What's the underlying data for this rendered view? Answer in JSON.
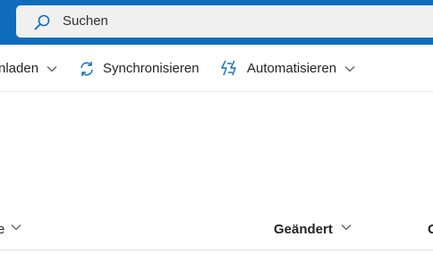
{
  "search": {
    "placeholder": "Suchen"
  },
  "commandbar": {
    "download_label": "nladen",
    "sync_label": "Synchronisieren",
    "automate_label": "Automatisieren"
  },
  "list_header": {
    "name_label": "e",
    "modified_label": "Geändert",
    "next_label": "G"
  },
  "colors": {
    "header_bg": "#0f6cbd",
    "accent": "#0f6cbd",
    "search_bg": "#f0f0f0"
  }
}
